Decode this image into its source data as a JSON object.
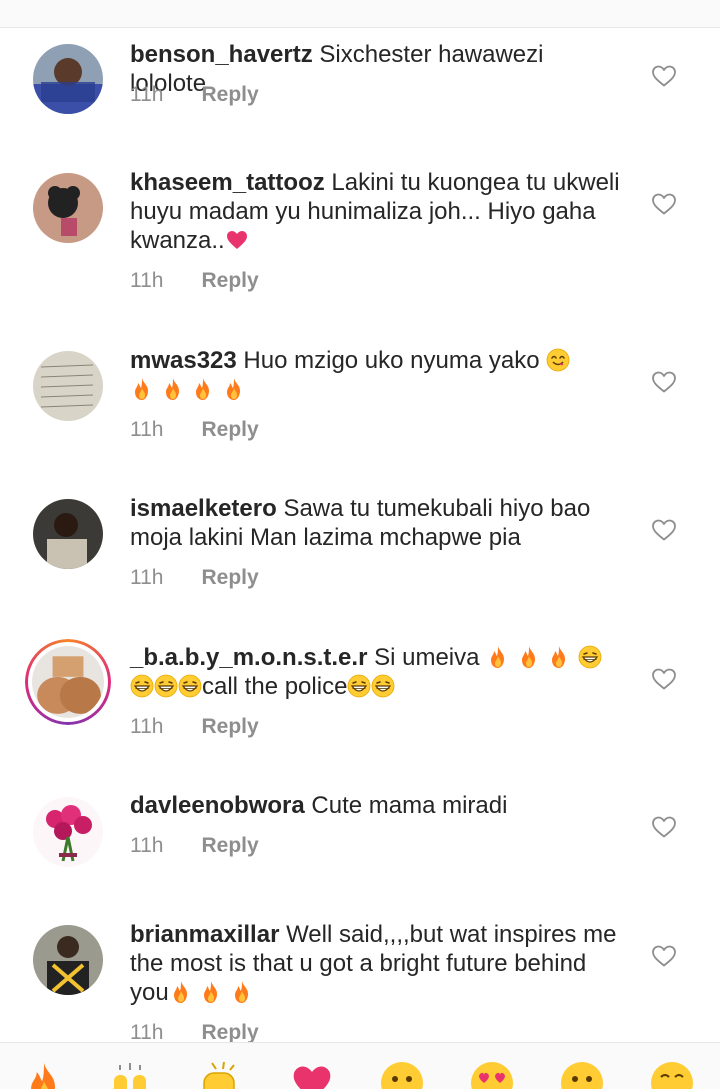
{
  "comments": [
    {
      "username": "benson_havertz",
      "text": "Sixchester hawawezi lololote",
      "time": "11h",
      "reply": "Reply"
    },
    {
      "username": "khaseem_tattooz",
      "text": "Lakini tu kuongea tu ukweli huyu madam yu hunimaliza joh... Hiyo gaha kwanza..",
      "time": "11h",
      "reply": "Reply"
    },
    {
      "username": "mwas323",
      "text": "Huo mzigo uko nyuma yako",
      "time": "11h",
      "reply": "Reply"
    },
    {
      "username": "ismaelketero",
      "text": "Sawa tu tumekubali hiyo bao moja lakini Man lazima mchapwe pia",
      "time": "11h",
      "reply": "Reply"
    },
    {
      "username": "_b.a.b.y_m.o.n.s.t.e.r",
      "text": "Si umeiva",
      "text2": "call the police",
      "time": "11h",
      "reply": "Reply"
    },
    {
      "username": "davleenobwora",
      "text": "Cute mama miradi",
      "time": "11h",
      "reply": "Reply"
    },
    {
      "username": "brianmaxillar",
      "text": "Well said,,,,but wat inspires me the most is that u got a bright future behind you",
      "time": "11h",
      "reply": "Reply"
    }
  ],
  "icons": {
    "like": "heart-outline-icon",
    "fire": "fire-emoji",
    "grin": "grinning-squint-emoji",
    "yum": "savoring-food-emoji",
    "heart": "red-heart-emoji"
  },
  "quick_reactions": [
    "fire",
    "raising-hands",
    "clapping-hands",
    "red-heart",
    "smiling-face",
    "heart-eyes",
    "astonished",
    "grinning"
  ],
  "colors": {
    "text": "#262626",
    "meta": "#8e8e8e",
    "fire": "#ff6a1a",
    "heart": "#e8336c"
  }
}
